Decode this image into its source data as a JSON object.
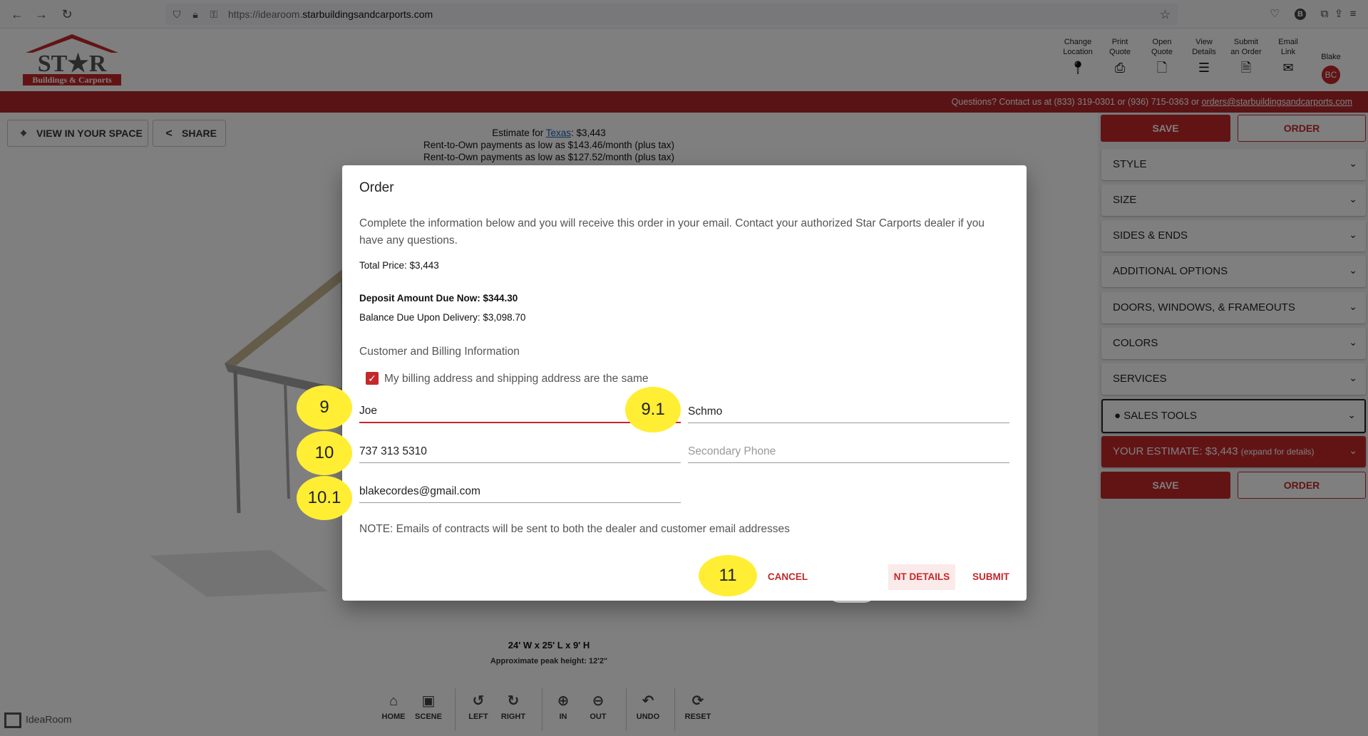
{
  "browser": {
    "url_prefix": "https://idearoom.",
    "url_domain": "starbuildingsandcarports.com",
    "profile_letter": "B"
  },
  "header": {
    "logo_text": "ST★R",
    "logo_sub": "Buildings & Carports",
    "actions": [
      {
        "line1": "Change",
        "line2": "Location",
        "icon": "location-pin-icon"
      },
      {
        "line1": "Print",
        "line2": "Quote",
        "icon": "printer-icon"
      },
      {
        "line1": "Open",
        "line2": "Quote",
        "icon": "open-quote-icon"
      },
      {
        "line1": "View",
        "line2": "Details",
        "icon": "list-icon"
      },
      {
        "line1": "Submit",
        "line2": "an Order",
        "icon": "document-icon"
      },
      {
        "line1": "Email",
        "line2": "Link",
        "icon": "email-icon"
      }
    ],
    "user_name": "Blake",
    "user_initials": "BC"
  },
  "contact": {
    "text": "Questions? Contact us at (833) 319-0301 or (936) 715-0363 or ",
    "email": "orders@starbuildingsandcarports.com"
  },
  "main": {
    "view_in_space": "VIEW IN YOUR SPACE",
    "share": "SHARE",
    "estimate_prefix": "Estimate for ",
    "estimate_state": "Texas",
    "estimate_price": ": $3,443",
    "rto_1": "Rent-to-Own payments as low as $143.46/month (plus tax)",
    "rto_2": "Rent-to-Own payments as low as $127.52/month (plus tax)",
    "dimensions": "24' W x 25' L x 9' H",
    "peak_height": "Approximate peak height: 12'2\"",
    "toolbar": [
      "HOME",
      "SCENE",
      "LEFT",
      "RIGHT",
      "IN",
      "OUT",
      "UNDO",
      "RESET"
    ],
    "brand": "IdeaRoom"
  },
  "sidebar": {
    "save": "SAVE",
    "order": "ORDER",
    "sections": [
      "STYLE",
      "SIZE",
      "SIDES & ENDS",
      "ADDITIONAL OPTIONS",
      "DOORS, WINDOWS, & FRAMEOUTS",
      "COLORS",
      "SERVICES"
    ],
    "sales_tools": "SALES TOOLS",
    "estimate_label": "YOUR ESTIMATE: $3,443",
    "estimate_hint": "(expand for details)"
  },
  "dialog": {
    "title": "Order",
    "intro": "Complete the information below and you will receive this order in your email. Contact your authorized Star Carports dealer if you have any questions.",
    "total": "Total Price: $3,443",
    "deposit": "Deposit Amount Due Now: $344.30",
    "balance": "Balance Due Upon Delivery: $3,098.70",
    "section_title": "Customer and Billing Information",
    "billing_same_label": "My billing address and shipping address are the same",
    "billing_same_checked": true,
    "first_name": "Joe",
    "last_name": "Schmo",
    "phone": "737 313 5310",
    "secondary_phone_placeholder": "Secondary Phone",
    "email": "blakecordes@gmail.com",
    "note": "NOTE: Emails of contracts will be sent to both the dealer and customer email addresses",
    "cancel": "CANCEL",
    "details": "NT DETAILS",
    "submit": "SUBMIT"
  },
  "markers": [
    "9",
    "9.1",
    "10",
    "10.1",
    "11"
  ],
  "colors": {
    "brand_red": "#c4282b",
    "contact_bar": "#b5272a",
    "marker_yellow": "#ffee33"
  }
}
